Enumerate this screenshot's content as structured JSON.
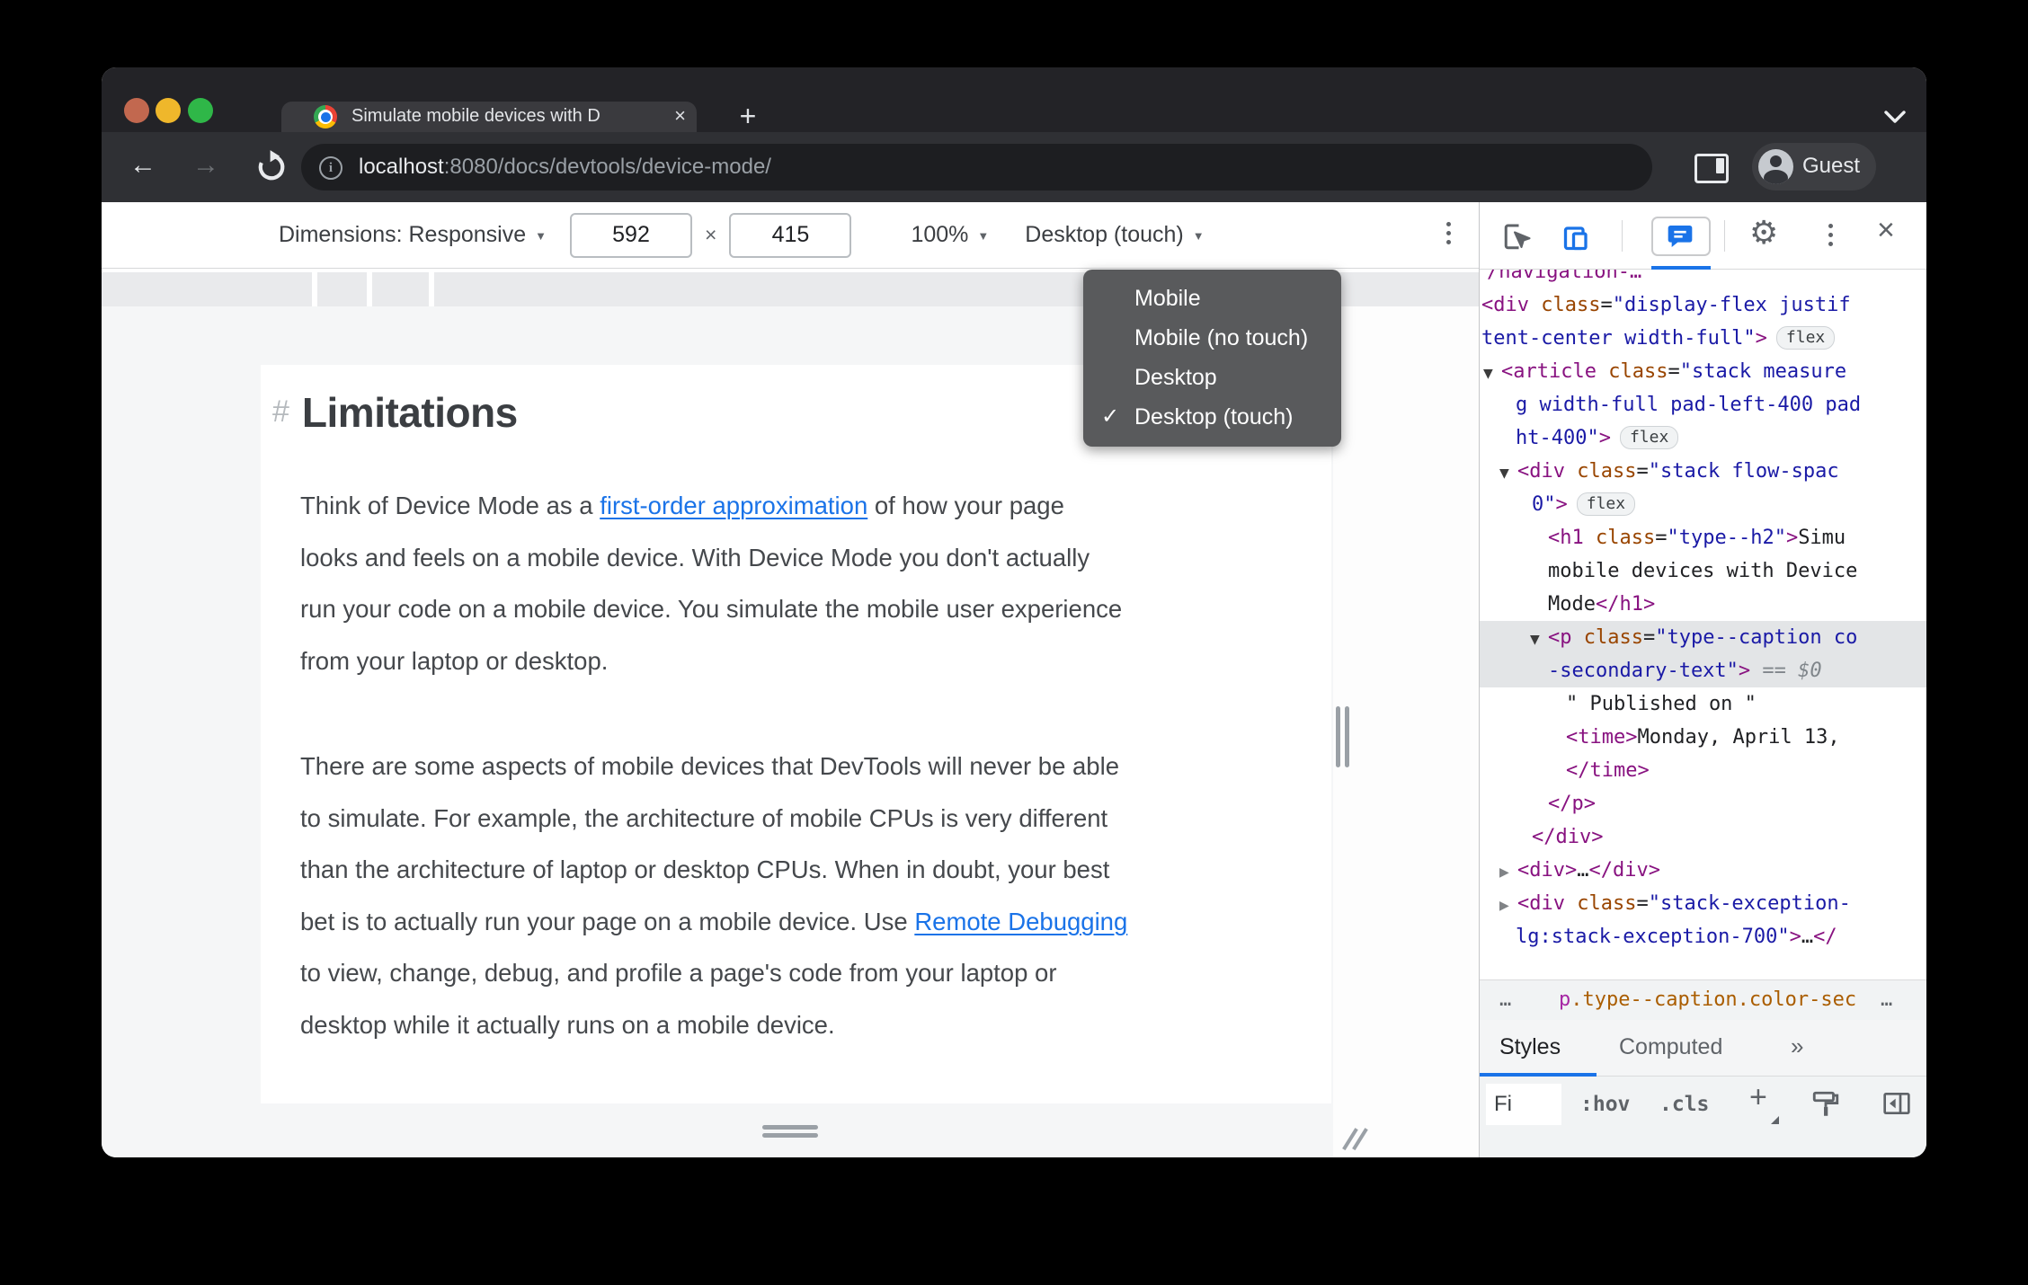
{
  "colors": {
    "accent_blue": "#1a73e8",
    "tag_purple": "#881280",
    "attr_orange": "#994500",
    "value_blue": "#1a1aa6",
    "menu_bg": "#595a5c"
  },
  "browser": {
    "tab_title": "Simulate mobile devices with D",
    "close_tab_glyph": "×",
    "new_tab_glyph": "+",
    "url_host": "localhost",
    "url_path": ":8080/docs/devtools/device-mode/",
    "guest_label": "Guest"
  },
  "device_toolbar": {
    "dimensions_label": "Dimensions: Responsive",
    "width_value": "592",
    "times_glyph": "×",
    "height_value": "415",
    "zoom_value": "100%",
    "device_type_value": "Desktop (touch)",
    "caret_glyph": "▼"
  },
  "device_menu": {
    "items": [
      {
        "label": "Mobile",
        "checked": false
      },
      {
        "label": "Mobile (no touch)",
        "checked": false
      },
      {
        "label": "Desktop",
        "checked": false
      },
      {
        "label": "Desktop (touch)",
        "checked": true
      }
    ],
    "check_glyph": "✓"
  },
  "page": {
    "heading_hash": "#",
    "heading": "Limitations",
    "paragraphs": [
      {
        "segments": [
          {
            "text": "Think of Device Mode as a "
          },
          {
            "link": "first-order approximation"
          },
          {
            "text": " of how your page"
          },
          {
            "br": true
          },
          {
            "text": "looks and feels on a mobile device. With Device Mode you don't actually"
          },
          {
            "br": true
          },
          {
            "text": "run your code on a mobile device. You simulate the mobile user experience"
          },
          {
            "br": true
          },
          {
            "text": "from your laptop or desktop."
          }
        ]
      },
      {
        "segments": [
          {
            "text": "There are some aspects of mobile devices that DevTools will never be able"
          },
          {
            "br": true
          },
          {
            "text": "to simulate. For example, the architecture of mobile CPUs is very different"
          },
          {
            "br": true
          },
          {
            "text": "than the architecture of laptop or desktop CPUs. When in doubt, your best"
          },
          {
            "br": true
          },
          {
            "text": "bet is to actually run your page on a mobile device. Use "
          },
          {
            "link": "Remote Debugging"
          },
          {
            "br": true
          },
          {
            "text": "to view, change, debug, and profile a page's code from your laptop or"
          },
          {
            "br": true
          },
          {
            "text": "desktop while it actually runs on a mobile device."
          }
        ]
      }
    ]
  },
  "devtools": {
    "code_rows": [
      {
        "ind": 8,
        "tri": null,
        "sel": false,
        "tokens": [
          [
            "tag",
            "/navigation-…"
          ]
        ]
      },
      {
        "ind": 2,
        "tri": null,
        "sel": false,
        "tokens": [
          [
            "tag",
            "<div"
          ],
          [
            "pln",
            " "
          ],
          [
            "attr",
            "class"
          ],
          [
            "pun",
            "="
          ],
          [
            "val",
            "\"display-flex justif"
          ]
        ]
      },
      {
        "ind": 2,
        "tri": null,
        "sel": false,
        "tokens": [
          [
            "val",
            "tent-center width-full\""
          ],
          [
            "tag",
            ">"
          ],
          [
            "badge",
            "flex"
          ]
        ]
      },
      {
        "ind": 4,
        "tri": "o",
        "sel": false,
        "tokens": [
          [
            "tag",
            "<article"
          ],
          [
            "pln",
            " "
          ],
          [
            "attr",
            "class"
          ],
          [
            "pun",
            "="
          ],
          [
            "val",
            "\"stack measure"
          ]
        ]
      },
      {
        "ind": 40,
        "tri": null,
        "sel": false,
        "tokens": [
          [
            "val",
            "g width-full pad-left-400 pad"
          ]
        ]
      },
      {
        "ind": 40,
        "tri": null,
        "sel": false,
        "tokens": [
          [
            "val",
            "ht-400\""
          ],
          [
            "tag",
            ">"
          ],
          [
            "badge",
            "flex"
          ]
        ]
      },
      {
        "ind": 22,
        "tri": "o",
        "sel": false,
        "tokens": [
          [
            "tag",
            "<div"
          ],
          [
            "pln",
            " "
          ],
          [
            "attr",
            "class"
          ],
          [
            "pun",
            "="
          ],
          [
            "val",
            "\"stack flow-spac"
          ]
        ]
      },
      {
        "ind": 58,
        "tri": null,
        "sel": false,
        "tokens": [
          [
            "val",
            "0\""
          ],
          [
            "tag",
            ">"
          ],
          [
            "badge",
            "flex"
          ]
        ]
      },
      {
        "ind": 76,
        "tri": null,
        "sel": false,
        "tokens": [
          [
            "tag",
            "<h1"
          ],
          [
            "pln",
            " "
          ],
          [
            "attr",
            "class"
          ],
          [
            "pun",
            "="
          ],
          [
            "val",
            "\"type--h2\""
          ],
          [
            "tag",
            ">"
          ],
          [
            "pln",
            "Simu"
          ]
        ]
      },
      {
        "ind": 76,
        "tri": null,
        "sel": false,
        "tokens": [
          [
            "pln",
            "mobile devices with Device"
          ]
        ]
      },
      {
        "ind": 76,
        "tri": null,
        "sel": false,
        "tokens": [
          [
            "pln",
            "Mode"
          ],
          [
            "tag",
            "</h1>"
          ]
        ]
      },
      {
        "ind": 56,
        "tri": "o",
        "sel": true,
        "tokens": [
          [
            "tag",
            "<p"
          ],
          [
            "pln",
            " "
          ],
          [
            "attr",
            "class"
          ],
          [
            "pun",
            "="
          ],
          [
            "val",
            "\"type--caption co"
          ]
        ]
      },
      {
        "ind": 76,
        "tri": null,
        "sel": true,
        "tokens": [
          [
            "val",
            "-secondary-text\""
          ],
          [
            "tag",
            ">"
          ],
          [
            "eq",
            " == "
          ],
          [
            "dollar",
            "$0"
          ]
        ]
      },
      {
        "ind": 96,
        "tri": null,
        "sel": false,
        "tokens": [
          [
            "pln",
            "\" Published on \""
          ]
        ]
      },
      {
        "ind": 96,
        "tri": null,
        "sel": false,
        "tokens": [
          [
            "tag",
            "<time>"
          ],
          [
            "pln",
            "Monday, April 13,"
          ]
        ]
      },
      {
        "ind": 96,
        "tri": null,
        "sel": false,
        "tokens": [
          [
            "tag",
            "</time>"
          ]
        ]
      },
      {
        "ind": 76,
        "tri": null,
        "sel": false,
        "tokens": [
          [
            "tag",
            "</p>"
          ]
        ]
      },
      {
        "ind": 58,
        "tri": null,
        "sel": false,
        "tokens": [
          [
            "tag",
            "</div>"
          ]
        ]
      },
      {
        "ind": 22,
        "tri": "c",
        "sel": false,
        "tokens": [
          [
            "tag",
            "<div>"
          ],
          [
            "pln",
            "…"
          ],
          [
            "tag",
            "</div>"
          ]
        ]
      },
      {
        "ind": 22,
        "tri": "c",
        "sel": false,
        "tokens": [
          [
            "tag",
            "<div"
          ],
          [
            "pln",
            " "
          ],
          [
            "attr",
            "class"
          ],
          [
            "pun",
            "="
          ],
          [
            "val",
            "\"stack-exception-"
          ]
        ]
      },
      {
        "ind": 40,
        "tri": null,
        "sel": false,
        "tokens": [
          [
            "val",
            "lg:stack-exception-700\""
          ],
          [
            "tag",
            ">"
          ],
          [
            "pln",
            "…"
          ],
          [
            "tag",
            "</"
          ]
        ]
      }
    ],
    "triangle_open": "▼",
    "triangle_closed": "▶",
    "breadcrumb": {
      "left_ellipsis": "…",
      "tag": "p",
      "classes": ".type--caption.color-sec",
      "right_ellipsis": "…"
    },
    "tabs": {
      "styles": "Styles",
      "computed": "Computed",
      "more": "»"
    },
    "filter": {
      "value": "Fi",
      "pseudo": ":hov",
      "cls": ".cls",
      "plus": "+"
    },
    "close_glyph": "×"
  }
}
